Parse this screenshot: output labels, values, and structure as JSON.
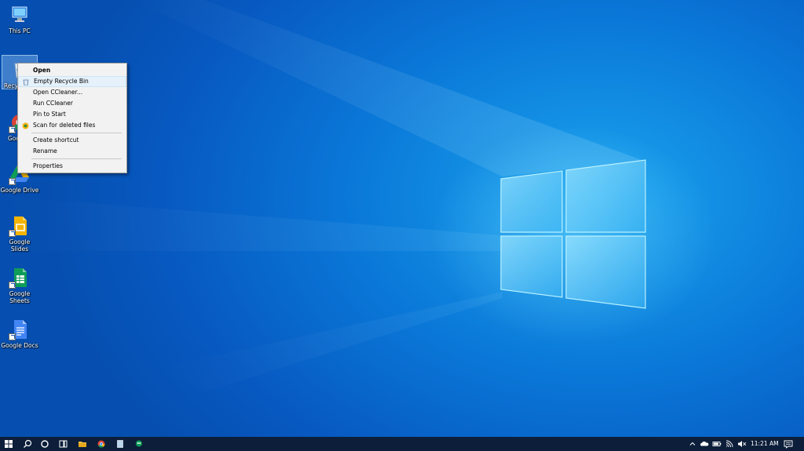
{
  "desktop": {
    "icons": [
      {
        "id": "this-pc",
        "label": "This PC"
      },
      {
        "id": "recycle-bin",
        "label": "Recyc"
      },
      {
        "id": "google-chrome",
        "label": "Goo Chr"
      },
      {
        "id": "google-drive",
        "label": "Google Drive"
      },
      {
        "id": "google-slides",
        "label": "Google Slides"
      },
      {
        "id": "google-sheets",
        "label": "Google Sheets"
      },
      {
        "id": "google-docs",
        "label": "Google Docs"
      }
    ]
  },
  "context_menu": {
    "items": {
      "open": "Open",
      "empty_recycle_bin": "Empty Recycle Bin",
      "open_ccleaner": "Open CCleaner...",
      "run_ccleaner": "Run CCleaner",
      "pin_to_start": "Pin to Start",
      "scan_deleted": "Scan for deleted files",
      "create_shortcut": "Create shortcut",
      "rename": "Rename",
      "properties": "Properties"
    }
  },
  "taskbar": {
    "clock": "11:21 AM",
    "colors": {
      "background": "#0c1e3a",
      "accent": "#0a78d8"
    }
  }
}
